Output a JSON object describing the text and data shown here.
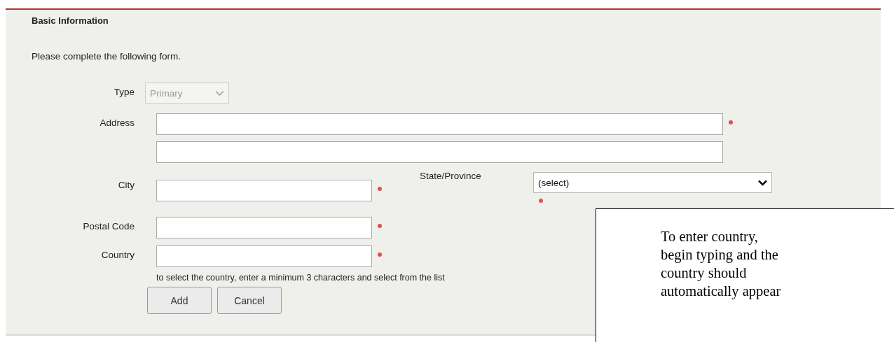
{
  "section": {
    "title": "Basic Information",
    "intro": "Please complete the following form."
  },
  "type": {
    "label": "Type",
    "value": "Primary",
    "disabled": true
  },
  "address": {
    "label": "Address",
    "required": true
  },
  "city": {
    "label": "City",
    "required": true
  },
  "state": {
    "label": "State/Province",
    "value": "(select)",
    "required": true
  },
  "postal_code": {
    "label": "Postal Code",
    "required": true
  },
  "country": {
    "label": "Country",
    "required": true,
    "hint": "to select the country, enter a minimum 3 characters and select from the list"
  },
  "buttons": [
    {
      "label": "Add"
    },
    {
      "label": "Cancel"
    }
  ],
  "callout": {
    "text": "To enter country, begin typing and the country should automatically appear"
  }
}
